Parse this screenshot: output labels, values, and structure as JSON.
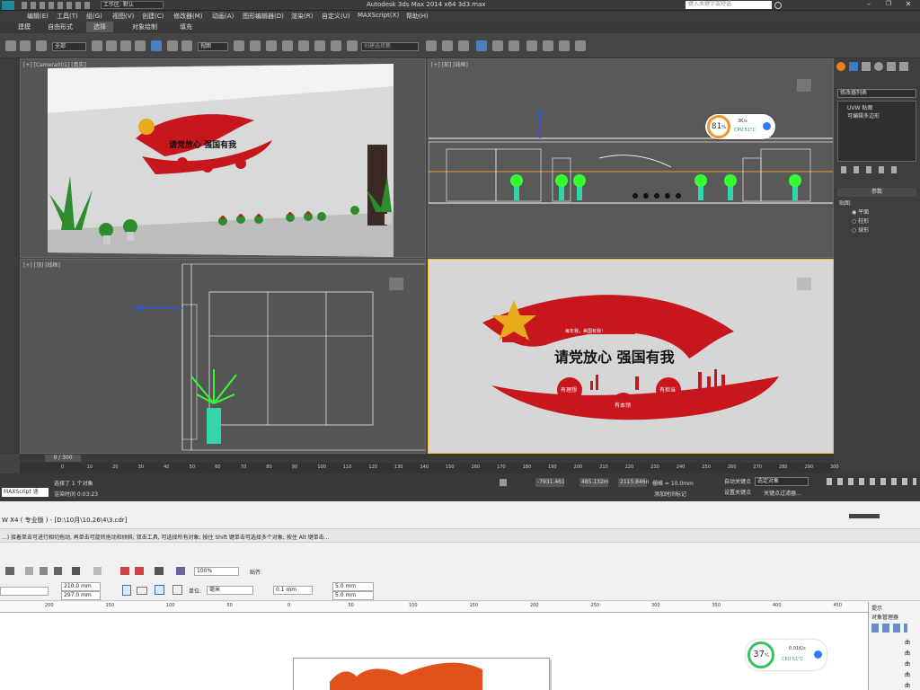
{
  "max": {
    "window_title": "Autodesk 3ds Max  2014 x64     3d3.max",
    "workspace_label": "工作区: 默认",
    "search_placeholder": "键入关键字或短语",
    "menus": [
      "编辑(E)",
      "工具(T)",
      "组(G)",
      "视图(V)",
      "创建(C)",
      "修改器(M)",
      "动画(A)",
      "图形编辑器(D)",
      "渲染(R)",
      "自定义(U)",
      "MAXScript(X)",
      "帮助(H)"
    ],
    "ribbon_tabs": [
      "建模",
      "自由形式",
      "选择",
      "对象绘制",
      "填充"
    ],
    "toolbar": {
      "filter_value": "全部",
      "view_value": "视图",
      "selection_set": "创建选择集"
    },
    "viewports": {
      "camera": "[+] [Camera001] [真实]",
      "front": "[+] [前] [线框]",
      "top": "[+] [顶] [线框]",
      "persp": ""
    },
    "cpu_top": {
      "percent": "81",
      "unit": "%",
      "rate": "3K/s",
      "temp": "CPU 51°C"
    },
    "command_panel": {
      "modifier_list": "修改器列表",
      "stack_item_1": "UVW 贴图",
      "stack_item_2": "可编辑多边形",
      "section_title": "参数",
      "mapping_label": "贴图:",
      "options": [
        "平面",
        "柱形",
        "球形"
      ]
    },
    "timeline": {
      "frame_display": "0 / 300",
      "ticks": [
        "0",
        "10",
        "20",
        "30",
        "40",
        "50",
        "60",
        "70",
        "80",
        "90",
        "100",
        "110",
        "120",
        "130",
        "140",
        "150",
        "160",
        "170",
        "180",
        "190",
        "200",
        "210",
        "220",
        "230",
        "240",
        "250",
        "260",
        "270",
        "280",
        "290",
        "300"
      ]
    },
    "status": {
      "script_label": "MAXScript 迷",
      "message": "选择了 1 个对象",
      "render_time": "渲染时间 0:03:23",
      "x": "-7931.461",
      "y": "485.132m",
      "z": "2115.846n",
      "grid": "栅格 = 10.0mm",
      "auto_key": "自动关键点",
      "set_key": "设置关键点",
      "selected": "选定对象",
      "add_time_tag": "添加时间标记",
      "key_filters": "关键点过滤器..."
    },
    "wall_design": {
      "slogan": "请党放心 强国有我",
      "small_banner": "每年我，美国有我！",
      "circle_1": "有理想",
      "circle_2": "有本领",
      "circle_3": "有担当"
    }
  },
  "corel": {
    "window_title": "W X4 ( 专业版 ) - [D:\\10月\\10.26\\4\\3.cdr]",
    "hint_text": "...) 接着单击可进行相切拖动, 再单击可旋转拖动和倾斜; 双击工具, 可选择所有对象; 按住 Shift 键单击可选择多个对象; 按住 Alt 键单击...",
    "zoom": "100%",
    "snap_label": "贴齐",
    "page_width": "210.0 mm",
    "page_height": "297.0 mm",
    "unit_label": "单位:",
    "unit_value": "毫米",
    "nudge": "0.1 mm",
    "dup_x": "5.0 mm",
    "dup_y": "5.0 mm",
    "ruler_ticks": [
      "200",
      "150",
      "100",
      "50",
      "0",
      "50",
      "100",
      "150",
      "200",
      "250",
      "300",
      "350",
      "400",
      "450"
    ],
    "cpu_bottom": {
      "percent": "37",
      "unit": "%",
      "rate": "0.01K/s",
      "temp": "CPU 51°C"
    },
    "docker": {
      "hint_label": "提示",
      "obj_manager": "对象管理器",
      "items": [
        "曲",
        "曲",
        "曲",
        "曲",
        "曲"
      ]
    }
  }
}
